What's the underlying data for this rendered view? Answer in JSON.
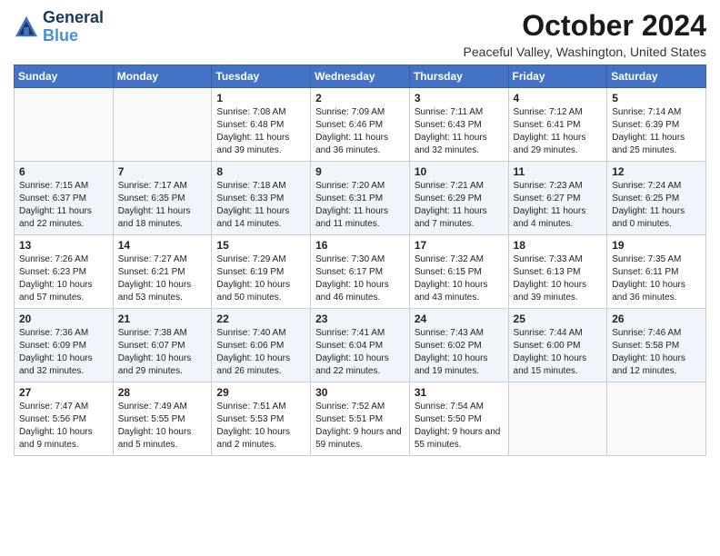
{
  "logo": {
    "line1": "General",
    "line2": "Blue"
  },
  "title": "October 2024",
  "subtitle": "Peaceful Valley, Washington, United States",
  "header_days": [
    "Sunday",
    "Monday",
    "Tuesday",
    "Wednesday",
    "Thursday",
    "Friday",
    "Saturday"
  ],
  "weeks": [
    [
      {
        "day": "",
        "info": ""
      },
      {
        "day": "",
        "info": ""
      },
      {
        "day": "1",
        "info": "Sunrise: 7:08 AM\nSunset: 6:48 PM\nDaylight: 11 hours and 39 minutes."
      },
      {
        "day": "2",
        "info": "Sunrise: 7:09 AM\nSunset: 6:46 PM\nDaylight: 11 hours and 36 minutes."
      },
      {
        "day": "3",
        "info": "Sunrise: 7:11 AM\nSunset: 6:43 PM\nDaylight: 11 hours and 32 minutes."
      },
      {
        "day": "4",
        "info": "Sunrise: 7:12 AM\nSunset: 6:41 PM\nDaylight: 11 hours and 29 minutes."
      },
      {
        "day": "5",
        "info": "Sunrise: 7:14 AM\nSunset: 6:39 PM\nDaylight: 11 hours and 25 minutes."
      }
    ],
    [
      {
        "day": "6",
        "info": "Sunrise: 7:15 AM\nSunset: 6:37 PM\nDaylight: 11 hours and 22 minutes."
      },
      {
        "day": "7",
        "info": "Sunrise: 7:17 AM\nSunset: 6:35 PM\nDaylight: 11 hours and 18 minutes."
      },
      {
        "day": "8",
        "info": "Sunrise: 7:18 AM\nSunset: 6:33 PM\nDaylight: 11 hours and 14 minutes."
      },
      {
        "day": "9",
        "info": "Sunrise: 7:20 AM\nSunset: 6:31 PM\nDaylight: 11 hours and 11 minutes."
      },
      {
        "day": "10",
        "info": "Sunrise: 7:21 AM\nSunset: 6:29 PM\nDaylight: 11 hours and 7 minutes."
      },
      {
        "day": "11",
        "info": "Sunrise: 7:23 AM\nSunset: 6:27 PM\nDaylight: 11 hours and 4 minutes."
      },
      {
        "day": "12",
        "info": "Sunrise: 7:24 AM\nSunset: 6:25 PM\nDaylight: 11 hours and 0 minutes."
      }
    ],
    [
      {
        "day": "13",
        "info": "Sunrise: 7:26 AM\nSunset: 6:23 PM\nDaylight: 10 hours and 57 minutes."
      },
      {
        "day": "14",
        "info": "Sunrise: 7:27 AM\nSunset: 6:21 PM\nDaylight: 10 hours and 53 minutes."
      },
      {
        "day": "15",
        "info": "Sunrise: 7:29 AM\nSunset: 6:19 PM\nDaylight: 10 hours and 50 minutes."
      },
      {
        "day": "16",
        "info": "Sunrise: 7:30 AM\nSunset: 6:17 PM\nDaylight: 10 hours and 46 minutes."
      },
      {
        "day": "17",
        "info": "Sunrise: 7:32 AM\nSunset: 6:15 PM\nDaylight: 10 hours and 43 minutes."
      },
      {
        "day": "18",
        "info": "Sunrise: 7:33 AM\nSunset: 6:13 PM\nDaylight: 10 hours and 39 minutes."
      },
      {
        "day": "19",
        "info": "Sunrise: 7:35 AM\nSunset: 6:11 PM\nDaylight: 10 hours and 36 minutes."
      }
    ],
    [
      {
        "day": "20",
        "info": "Sunrise: 7:36 AM\nSunset: 6:09 PM\nDaylight: 10 hours and 32 minutes."
      },
      {
        "day": "21",
        "info": "Sunrise: 7:38 AM\nSunset: 6:07 PM\nDaylight: 10 hours and 29 minutes."
      },
      {
        "day": "22",
        "info": "Sunrise: 7:40 AM\nSunset: 6:06 PM\nDaylight: 10 hours and 26 minutes."
      },
      {
        "day": "23",
        "info": "Sunrise: 7:41 AM\nSunset: 6:04 PM\nDaylight: 10 hours and 22 minutes."
      },
      {
        "day": "24",
        "info": "Sunrise: 7:43 AM\nSunset: 6:02 PM\nDaylight: 10 hours and 19 minutes."
      },
      {
        "day": "25",
        "info": "Sunrise: 7:44 AM\nSunset: 6:00 PM\nDaylight: 10 hours and 15 minutes."
      },
      {
        "day": "26",
        "info": "Sunrise: 7:46 AM\nSunset: 5:58 PM\nDaylight: 10 hours and 12 minutes."
      }
    ],
    [
      {
        "day": "27",
        "info": "Sunrise: 7:47 AM\nSunset: 5:56 PM\nDaylight: 10 hours and 9 minutes."
      },
      {
        "day": "28",
        "info": "Sunrise: 7:49 AM\nSunset: 5:55 PM\nDaylight: 10 hours and 5 minutes."
      },
      {
        "day": "29",
        "info": "Sunrise: 7:51 AM\nSunset: 5:53 PM\nDaylight: 10 hours and 2 minutes."
      },
      {
        "day": "30",
        "info": "Sunrise: 7:52 AM\nSunset: 5:51 PM\nDaylight: 9 hours and 59 minutes."
      },
      {
        "day": "31",
        "info": "Sunrise: 7:54 AM\nSunset: 5:50 PM\nDaylight: 9 hours and 55 minutes."
      },
      {
        "day": "",
        "info": ""
      },
      {
        "day": "",
        "info": ""
      }
    ]
  ]
}
